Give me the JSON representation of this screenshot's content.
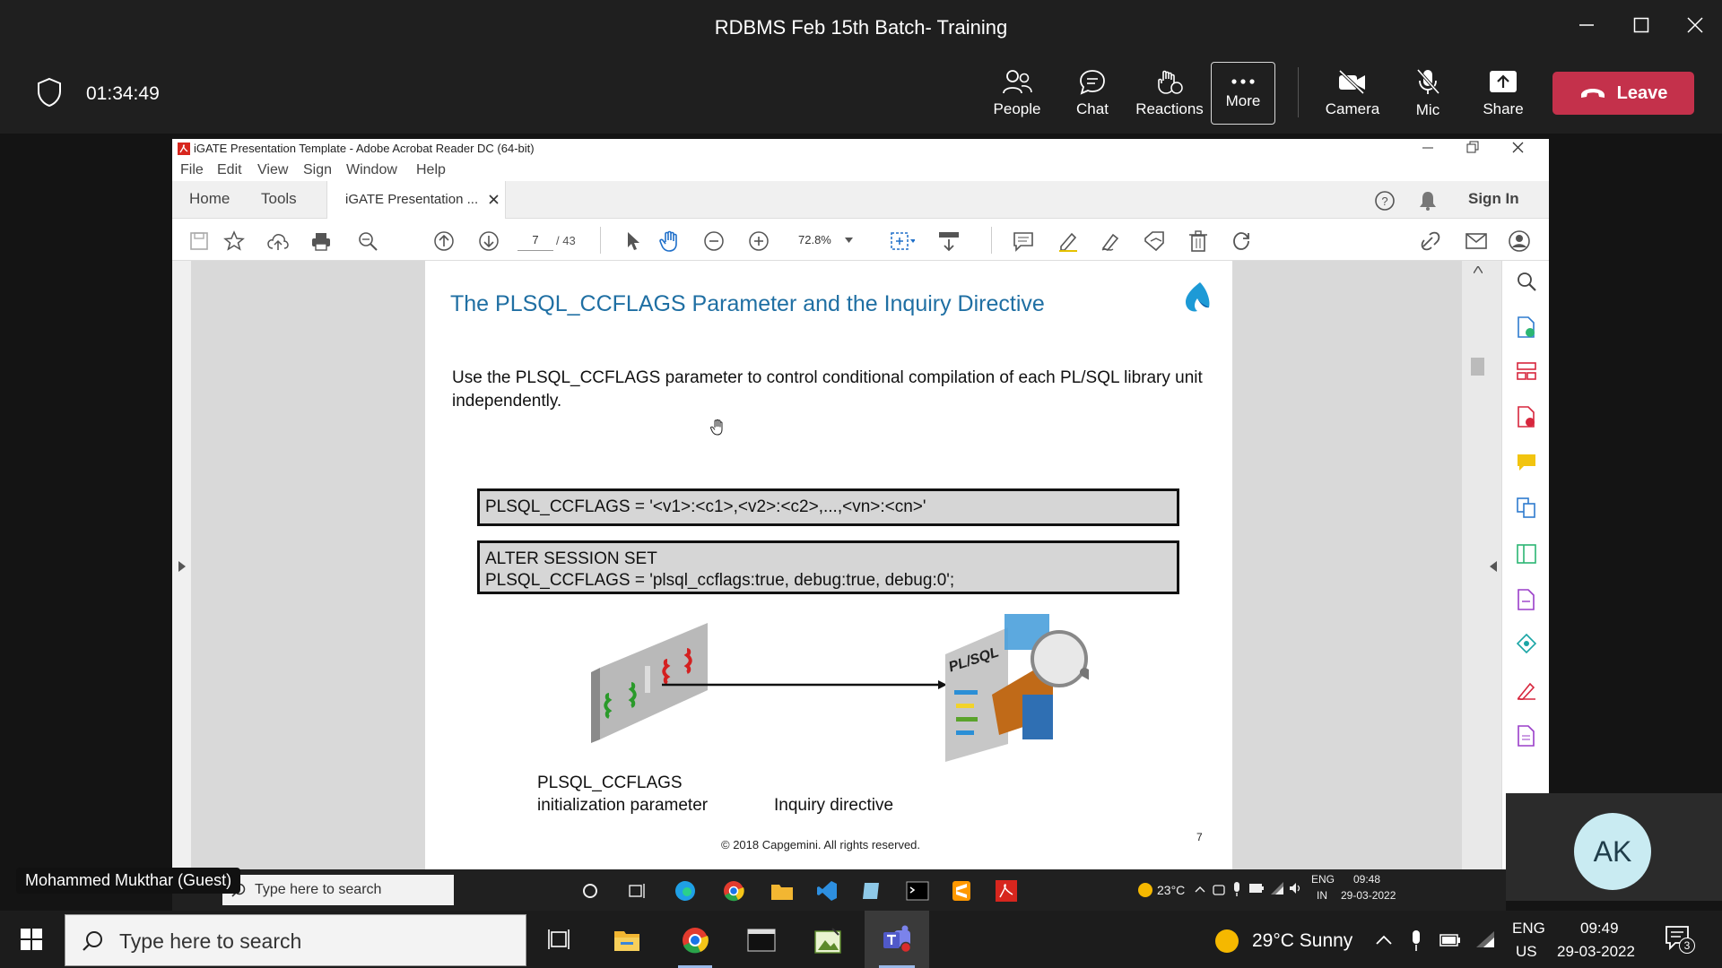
{
  "teams": {
    "window_title": "RDBMS Feb 15th Batch- Training",
    "timer": "01:34:49",
    "buttons": {
      "people": "People",
      "chat": "Chat",
      "reactions": "Reactions",
      "more": "More",
      "camera": "Camera",
      "mic": "Mic",
      "share": "Share",
      "leave": "Leave"
    },
    "participant_initials": "AK",
    "presenter_name": "Mohammed Mukthar (Guest)"
  },
  "acrobat": {
    "window_title": "iGATE Presentation Template - Adobe Acrobat Reader DC (64-bit)",
    "menu": [
      "File",
      "Edit",
      "View",
      "Sign",
      "Window",
      "Help"
    ],
    "tabs": {
      "home": "Home",
      "tools": "Tools",
      "document": "iGATE Presentation ..."
    },
    "sign_in": "Sign In",
    "page_current": "7",
    "page_total": "/ 43",
    "zoom": "72.8%"
  },
  "slide": {
    "title": "The PLSQL_CCFLAGS Parameter and the Inquiry Directive",
    "body": "Use the PLSQL_CCFLAGS parameter to control conditional compilation of each PL/SQL library unit independently.",
    "code1": "PLSQL_CCFLAGS = '<v1>:<c1>,<v2>:<c2>,...,<vn>:<cn>'",
    "code2_line1": "ALTER SESSION SET",
    "code2_line2": "PLSQL_CCFLAGS = 'plsql_ccflags:true, debug:true, debug:0';",
    "caption_left_1": "PLSQL_CCFLAGS",
    "caption_left_2": "initialization parameter",
    "caption_right": "Inquiry directive",
    "diagram_label": "PL/SQL",
    "copyright": "© 2018 Capgemini. All rights reserved.",
    "page_number": "7"
  },
  "inner_taskbar": {
    "search_placeholder": "Type here to search",
    "weather": "23°C",
    "lang_1": "ENG",
    "lang_2": "IN",
    "time": "09:48",
    "date": "29-03-2022"
  },
  "taskbar": {
    "search_placeholder": "Type here to search",
    "weather": "29°C  Sunny",
    "lang_1": "ENG",
    "lang_2": "US",
    "time": "09:49",
    "date": "29-03-2022",
    "notifications": "3"
  }
}
